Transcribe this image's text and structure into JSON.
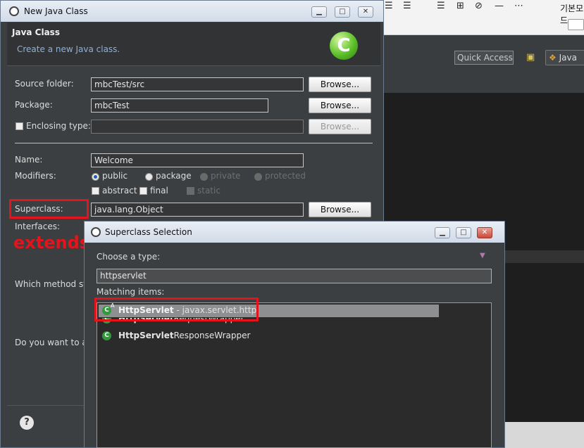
{
  "background": {
    "korean_label": "기본모드",
    "quick_access": "Quick Access",
    "perspective": "Java"
  },
  "dialog1": {
    "title": "New Java Class",
    "header_title": "Java Class",
    "header_desc": "Create a new Java class.",
    "fields": {
      "source_folder_label": "Source folder:",
      "source_folder_value": "mbcTest/src",
      "package_label": "Package:",
      "package_value": "mbcTest",
      "enclosing_label": "Enclosing type:",
      "enclosing_value": "",
      "name_label": "Name:",
      "name_value": "Welcome",
      "modifiers_label": "Modifiers:",
      "superclass_label": "Superclass:",
      "superclass_value": "java.lang.Object",
      "interfaces_label": "Interfaces:"
    },
    "modifiers": {
      "public": "public",
      "package": "package",
      "private": "private",
      "protected": "protected",
      "abstract": "abstract",
      "final": "final",
      "static": "static"
    },
    "browse_label": "Browse...",
    "annotation": "extends",
    "method_stubs_text": "Which method stu",
    "comments_text": "Do you want to a",
    "help_icon": "?"
  },
  "dialog2": {
    "title": "Superclass Selection",
    "choose_label": "Choose a type:",
    "search_value": "httpservlet",
    "matching_label": "Matching items:",
    "items": [
      {
        "bold": "HttpServlet",
        "rest": " - javax.servlet.http",
        "selected": true
      },
      {
        "bold": "HttpServlet",
        "rest": "RequestWrapper",
        "selected": false
      },
      {
        "bold": "HttpServlet",
        "rest": "ResponseWrapper",
        "selected": false
      }
    ]
  },
  "colors": {
    "highlight_red": "#e3141b",
    "dialog_bg": "#3c3f41",
    "class_icon_green": "#2f9a3a"
  }
}
